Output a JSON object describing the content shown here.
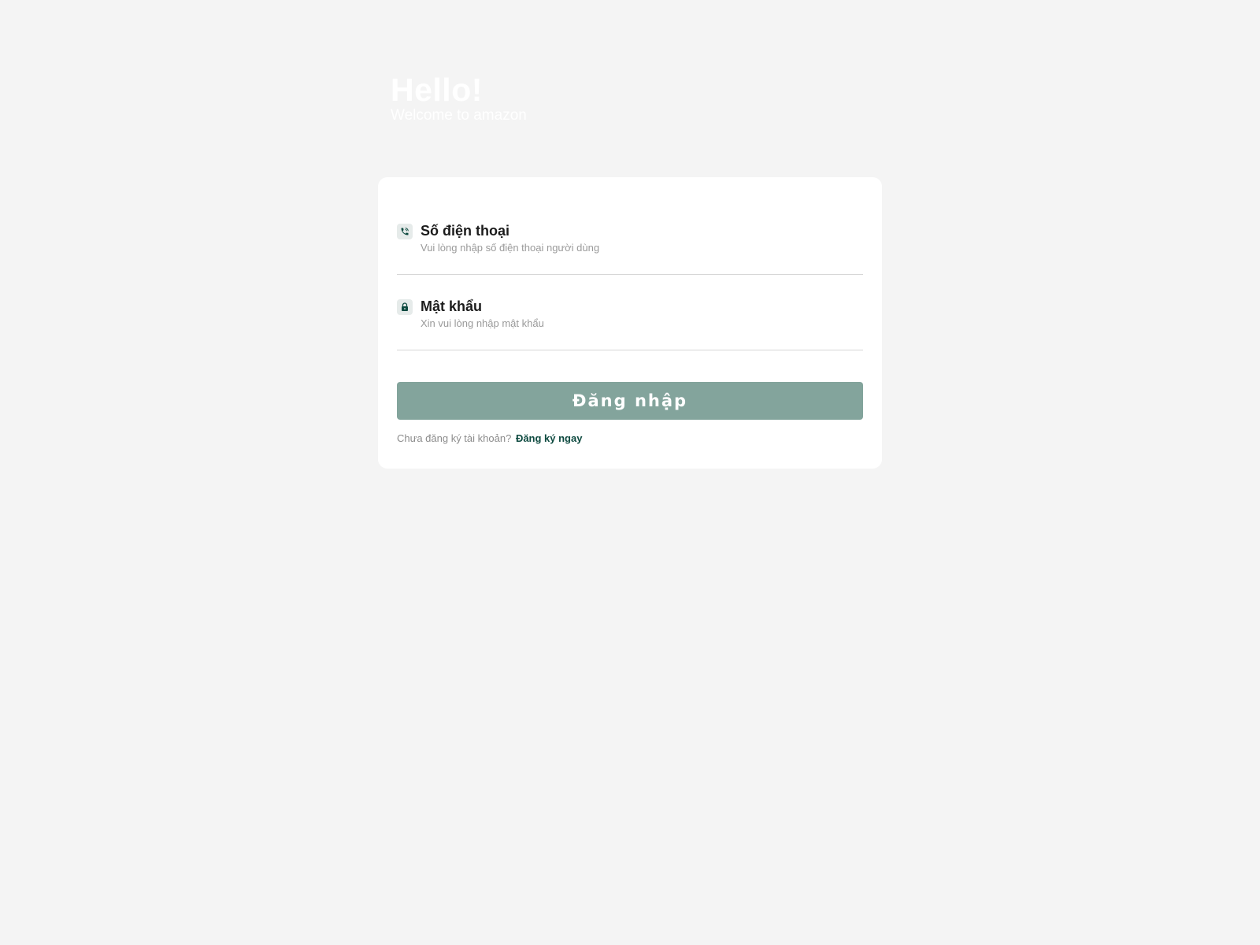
{
  "hero": {
    "title": "Hello!",
    "subtitle": "Welcome to amazon"
  },
  "form": {
    "phone": {
      "label": "Số điện thoại",
      "placeholder": "Vui lòng nhập số điện thoại người dùng",
      "icon": "phone-icon"
    },
    "password": {
      "label": "Mật khẩu",
      "placeholder": "Xin vui lòng nhập mật khẩu",
      "icon": "lock-icon"
    },
    "submit_label": "Đăng nhập",
    "signup_prompt": "Chưa đăng ký tài khoản?",
    "signup_link": "Đăng ký ngay"
  },
  "colors": {
    "background": "#f4f4f4",
    "card": "#ffffff",
    "button": "#83a49c",
    "accent": "#0e4a40",
    "icon_bg": "#e6ebea"
  }
}
